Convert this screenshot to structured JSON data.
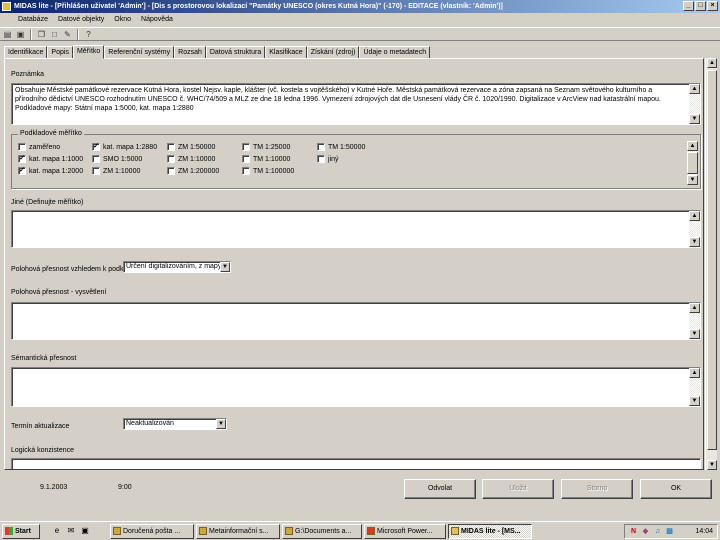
{
  "window": {
    "title": "MIDAS lite - [Přihlášen uživatel 'Admin'] - [Dis s prostorovou lokalizací \"Památky UNESCO (okres Kutná Hora)\" (-170) - EDITACE (vlastník: 'Admin')]",
    "minimize": "_",
    "maximize": "□",
    "close": "×"
  },
  "menu": [
    "Databáze",
    "Datové objekty",
    "Okno",
    "Nápověda"
  ],
  "toolbar": {
    "icons": [
      "database-icon",
      "save-icon",
      "copy-icon",
      "document-icon",
      "new-icon",
      "help-icon"
    ]
  },
  "tabs": [
    "Identifikace",
    "Popis",
    "Měřítko",
    "Referenční systémy",
    "Rozsah",
    "Datová struktura",
    "Klasifikace",
    "Získání (zdroj)",
    "Údaje o metadatech"
  ],
  "active_tab": 2,
  "form": {
    "popis_label": "Poznámka",
    "popis_text": "Obsahuje Městské památkové rezervace Kutná Hora, kostel Nejsv. kaple, klášter (vč. kostela s vojtěšského) v Kutné Hoře. Městská památková rezervace a zóna zapsaná na Seznam světového kulturního a přírodního dědictví UNESCO rozhodnutím UNESCO č. WHC/74/509 a MLZ ze dne 18 ledna 1996. Vymezení zdrojových dat dle Usnesení vlády ČR č. 1020/1990. Digitalizace v ArcView nad katastrální mapou.\nPodkladové mapy: Státní mapa 1:5000, kat. mapa 1:2880",
    "meritko_legend": "Podkladové měřítko",
    "checkboxes": [
      {
        "label": "zaměřeno",
        "checked": false
      },
      {
        "label": "kat. mapa 1:2880",
        "checked": true
      },
      {
        "label": "ZM 1:50000",
        "checked": false
      },
      {
        "label": "TM 1:25000",
        "checked": false
      },
      {
        "label": "TM 1:50000",
        "checked": false
      },
      {
        "label": "kat. mapa 1:1000",
        "checked": true
      },
      {
        "label": "SMO 1:5000",
        "checked": false
      },
      {
        "label": "ZM 1:10000",
        "checked": false
      },
      {
        "label": "TM 1:10000",
        "checked": false
      },
      {
        "label": "jiný",
        "checked": false
      },
      {
        "label": "kat. mapa 1:2000",
        "checked": true
      },
      {
        "label": "ZM 1:10000",
        "checked": false
      },
      {
        "label": "ZM 1:200000",
        "checked": false
      },
      {
        "label": "TM 1:100000",
        "checked": false
      }
    ],
    "jine_meritko_label": "Jiné (Definujte měřítko)",
    "presnost_label": "Polohová přesnost vzhledem k podkladu",
    "presnost_value": "Určení digitalizováním, z mapy",
    "polohova_label": "Polohová přesnost - vysvětlení",
    "semanticka_label": "Sémantická přesnost",
    "aktualizace_label": "Termín aktualizace",
    "aktualizace_value": "Neaktualizován",
    "logicka_label": "Logická konzistence"
  },
  "buttons": {
    "zrusit": "Odvolat",
    "zpet": "Uložit",
    "storno": "Storno",
    "ok": "OK"
  },
  "status": {
    "date": "9.1.2003",
    "time": "9:00"
  },
  "taskbar": {
    "start": "Start",
    "tasks": [
      "Doručená pošta ...",
      "Metainformační s...",
      "G:\\Documents a...",
      "Microsoft Power...",
      "MIDAS lite - [MS..."
    ],
    "active_task": 4,
    "clock": "14:04"
  }
}
